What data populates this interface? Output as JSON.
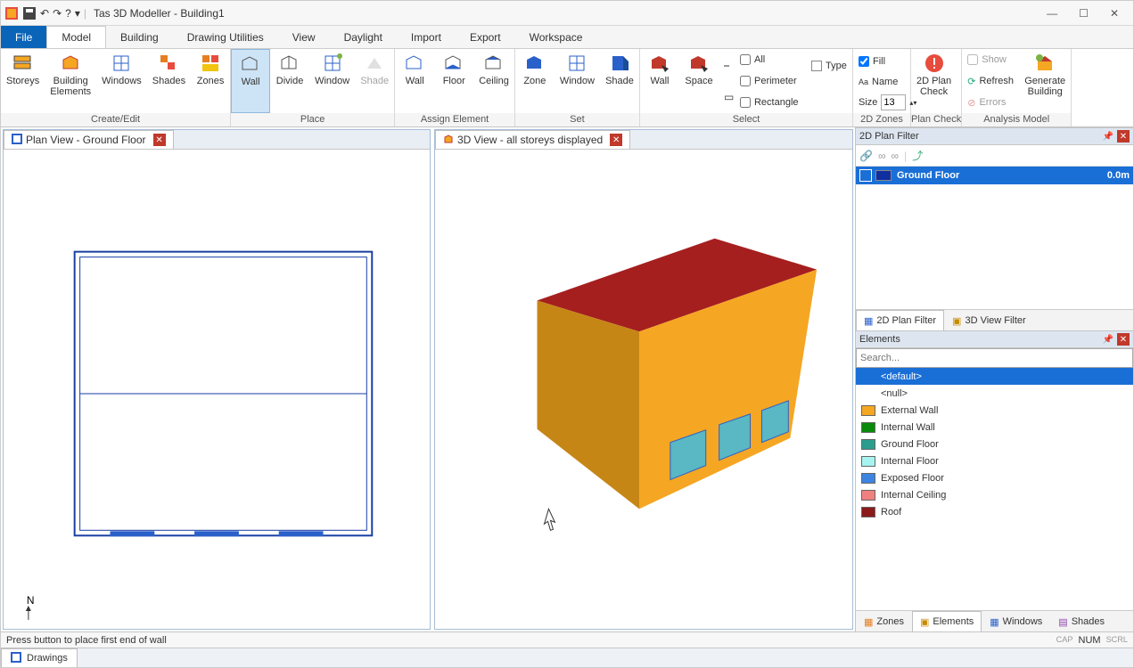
{
  "app_title": "Tas 3D Modeller - Building1",
  "quick_access": {
    "undo": "↶",
    "redo": "↷",
    "help": "?",
    "dropdown": "▾"
  },
  "window_controls": {
    "min": "—",
    "max": "☐",
    "close": "✕"
  },
  "tabs": {
    "file": "File",
    "items": [
      "Model",
      "Building",
      "Drawing Utilities",
      "View",
      "Daylight",
      "Import",
      "Export",
      "Workspace"
    ],
    "active": "Model"
  },
  "ribbon": {
    "create_edit": {
      "label": "Create/Edit",
      "buttons": [
        {
          "id": "storeys",
          "label": "Storeys"
        },
        {
          "id": "building-elements",
          "label": "Building\nElements"
        },
        {
          "id": "windows",
          "label": "Windows"
        },
        {
          "id": "shades",
          "label": "Shades"
        },
        {
          "id": "zones",
          "label": "Zones"
        }
      ]
    },
    "place": {
      "label": "Place",
      "buttons": [
        {
          "id": "wall",
          "label": "Wall",
          "selected": true
        },
        {
          "id": "divide",
          "label": "Divide"
        },
        {
          "id": "window",
          "label": "Window"
        },
        {
          "id": "shade",
          "label": "Shade",
          "disabled": true
        }
      ]
    },
    "assign_element": {
      "label": "Assign Element",
      "buttons": [
        {
          "id": "ae-wall",
          "label": "Wall"
        },
        {
          "id": "ae-floor",
          "label": "Floor"
        },
        {
          "id": "ae-ceiling",
          "label": "Ceiling"
        }
      ]
    },
    "set": {
      "label": "Set",
      "buttons": [
        {
          "id": "set-zone",
          "label": "Zone"
        },
        {
          "id": "set-window",
          "label": "Window"
        },
        {
          "id": "set-shade",
          "label": "Shade"
        }
      ]
    },
    "select": {
      "label": "Select",
      "buttons": [
        {
          "id": "sel-wall",
          "label": "Wall"
        },
        {
          "id": "sel-space",
          "label": "Space"
        }
      ],
      "icons": {
        "line": "⎯",
        "rect": "▭"
      },
      "checks": {
        "all": "All",
        "perimeter": "Perimeter",
        "rectangle": "Rectangle"
      },
      "type": "Type"
    },
    "zones2d": {
      "label": "2D Zones",
      "fill": "Fill",
      "name": "Name",
      "size_label": "Size",
      "size_value": "13"
    },
    "plan_check": {
      "label": "Plan Check",
      "button": "2D Plan\nCheck"
    },
    "analysis_model": {
      "label": "Analysis Model",
      "show": "Show",
      "refresh": "Refresh",
      "errors": "Errors",
      "generate": "Generate\nBuilding"
    }
  },
  "plan_view": {
    "title": "Plan View - Ground Floor",
    "north": "N"
  },
  "threed_view": {
    "title": "3D View - all storeys displayed"
  },
  "filter_panel": {
    "title": "2D Plan Filter",
    "item": {
      "name": "Ground Floor",
      "height": "0.0m"
    },
    "tabs": {
      "plan": "2D Plan Filter",
      "view": "3D View Filter"
    }
  },
  "elements_panel": {
    "title": "Elements",
    "search_placeholder": "Search...",
    "items": [
      {
        "name": "<default>",
        "color": null,
        "selected": true
      },
      {
        "name": "<null>",
        "color": null
      },
      {
        "name": "External Wall",
        "color": "#f5a623"
      },
      {
        "name": "Internal Wall",
        "color": "#0a8a0a"
      },
      {
        "name": "Ground Floor",
        "color": "#2a9d8f"
      },
      {
        "name": "Internal Floor",
        "color": "#a7f3f0"
      },
      {
        "name": "Exposed Floor",
        "color": "#3d84e0"
      },
      {
        "name": "Internal Ceiling",
        "color": "#f08080"
      },
      {
        "name": "Roof",
        "color": "#8b1a1a"
      }
    ],
    "tabs": [
      "Zones",
      "Elements",
      "Windows",
      "Shades"
    ],
    "active_tab": "Elements"
  },
  "status": {
    "message": "Press button to place first end of wall",
    "indicators": [
      "CAP",
      "NUM",
      "SCRL"
    ]
  },
  "footer_tab": "Drawings"
}
